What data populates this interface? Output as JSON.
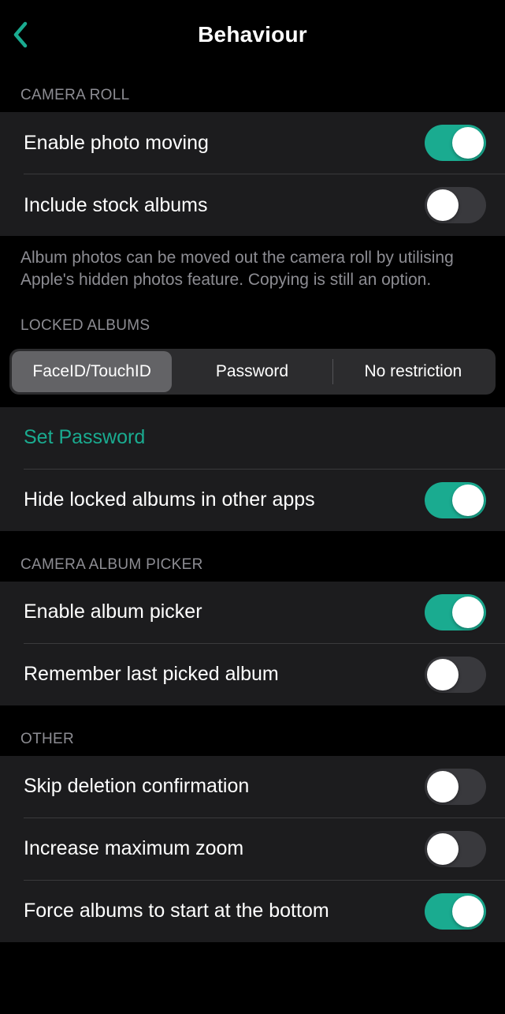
{
  "header": {
    "title": "Behaviour"
  },
  "sections": {
    "cameraRoll": {
      "header": "CAMERA ROLL",
      "enablePhotoMoving": "Enable photo moving",
      "includeStockAlbums": "Include stock albums",
      "footer": "Album photos can be moved out the camera roll by utilising Apple's hidden photos feature. Copying is still an option."
    },
    "lockedAlbums": {
      "header": "LOCKED ALBUMS",
      "segments": {
        "faceid": "FaceID/TouchID",
        "password": "Password",
        "none": "No restriction"
      },
      "setPassword": "Set Password",
      "hideLocked": "Hide locked albums in other apps"
    },
    "cameraAlbumPicker": {
      "header": "CAMERA ALBUM PICKER",
      "enablePicker": "Enable album picker",
      "rememberLast": "Remember last picked album"
    },
    "other": {
      "header": "OTHER",
      "skipDelete": "Skip deletion confirmation",
      "increaseZoom": "Increase maximum zoom",
      "forceBottom": "Force albums to start at the bottom"
    }
  },
  "colors": {
    "accent": "#1aab90"
  }
}
